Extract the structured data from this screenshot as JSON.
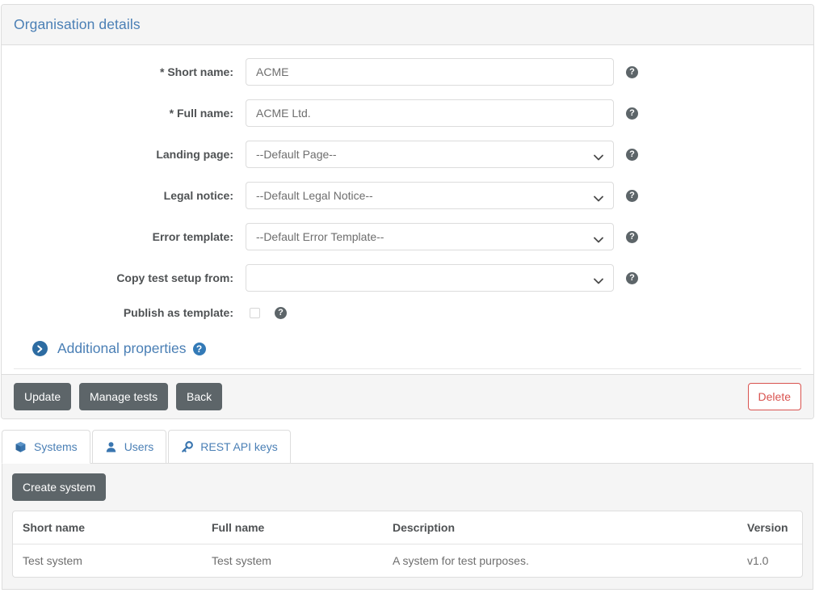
{
  "panel": {
    "title": "Organisation details",
    "fields": [
      {
        "label": "* Short name:",
        "type": "text",
        "value": "ACME",
        "placeholder": "",
        "help": "?",
        "name": "short-name"
      },
      {
        "label": "* Full name:",
        "type": "text",
        "value": "ACME Ltd.",
        "placeholder": "",
        "help": "?",
        "name": "full-name"
      },
      {
        "label": "Landing page:",
        "type": "select",
        "value": "--Default Page--",
        "help": "?",
        "name": "landing-page"
      },
      {
        "label": "Legal notice:",
        "type": "select",
        "value": "--Default Legal Notice--",
        "help": "?",
        "name": "legal-notice"
      },
      {
        "label": "Error template:",
        "type": "select",
        "value": "--Default Error Template--",
        "help": "?",
        "name": "error-template"
      },
      {
        "label": "Copy test setup from:",
        "type": "select",
        "value": "",
        "help": "?",
        "name": "copy-test-setup-from"
      },
      {
        "label": "Publish as template:",
        "type": "checkbox",
        "checked": false,
        "help": "?",
        "name": "publish-as-template"
      }
    ],
    "additional_properties": {
      "label": "Additional properties",
      "help": "?",
      "expand_icon": "chevron-right-circle"
    },
    "footer": {
      "buttons": [
        {
          "label": "Update",
          "name": "update-button"
        },
        {
          "label": "Manage tests",
          "name": "manage-tests-button"
        },
        {
          "label": "Back",
          "name": "back-button"
        }
      ],
      "delete": {
        "label": "Delete",
        "name": "delete-button"
      }
    }
  },
  "tabs": [
    {
      "label": "Systems",
      "icon": "cube-icon",
      "active": true
    },
    {
      "label": "Users",
      "icon": "user-icon",
      "active": false
    },
    {
      "label": "REST API keys",
      "icon": "key-icon",
      "active": false
    }
  ],
  "systems_tab": {
    "create_button": "Create system",
    "table": {
      "columns": [
        "Short name",
        "Full name",
        "Description",
        "Version"
      ],
      "rows": [
        [
          "Test system",
          "Test system",
          "A system for test purposes.",
          "v1.0"
        ]
      ]
    }
  },
  "colors": {
    "link": "#4a7fb5",
    "accent": "#337ab7",
    "button": "#5d6569",
    "danger": "#d9534f",
    "panel_heading_bg": "#f5f5f5",
    "border": "#dddddd"
  }
}
